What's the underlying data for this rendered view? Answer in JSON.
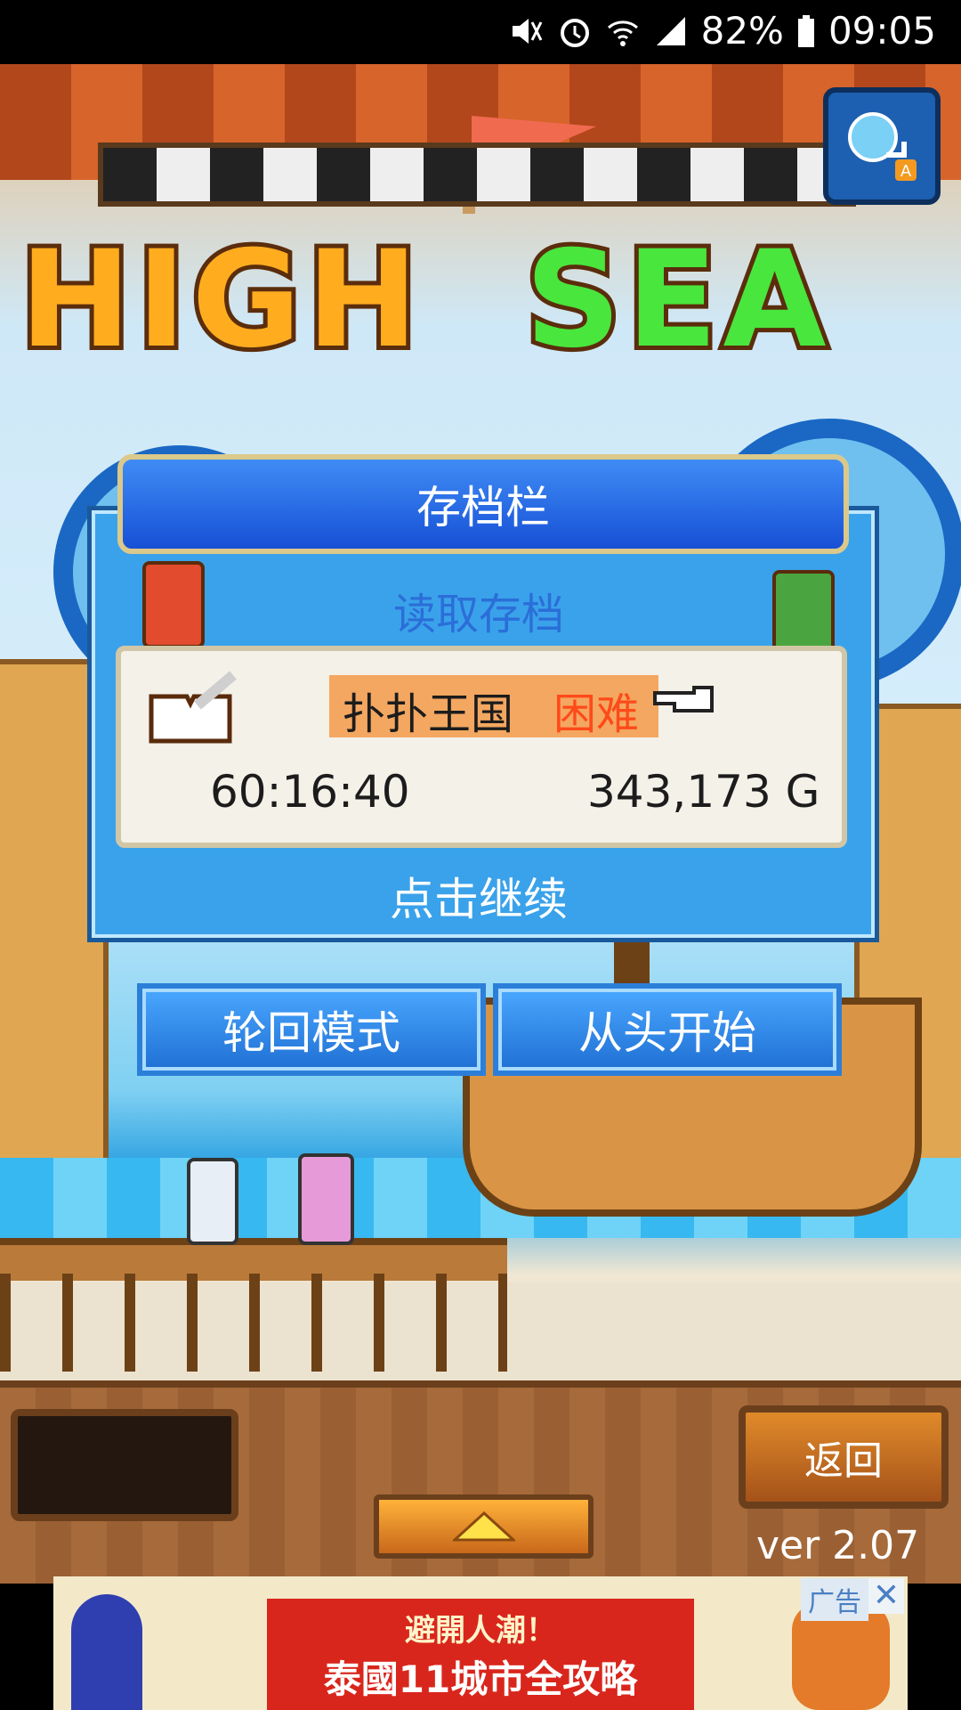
{
  "status_bar": {
    "battery": "82%",
    "time": "09:05",
    "icons": [
      "mute-icon",
      "alarm-icon",
      "wifi-icon",
      "signal-icon",
      "battery-icon"
    ]
  },
  "game": {
    "title_part1": "HIGH",
    "title_part2": "SEA",
    "account_icon": "account-switch-icon"
  },
  "save_dialog": {
    "title": "存档栏",
    "subtitle": "读取存档",
    "slot": {
      "name": "扑扑王国",
      "difficulty": "困难",
      "play_time": "60:16:40",
      "gold": "343,173 G"
    },
    "continue_label": "点击继续"
  },
  "mode_buttons": {
    "cycle_mode": "轮回模式",
    "new_game": "从头开始"
  },
  "bottom": {
    "back_label": "返回",
    "version": "ver 2.07"
  },
  "ad": {
    "line1": "避開人潮！",
    "line2": "泰國11城市全攻略",
    "label": "广告",
    "close": "✕"
  }
}
